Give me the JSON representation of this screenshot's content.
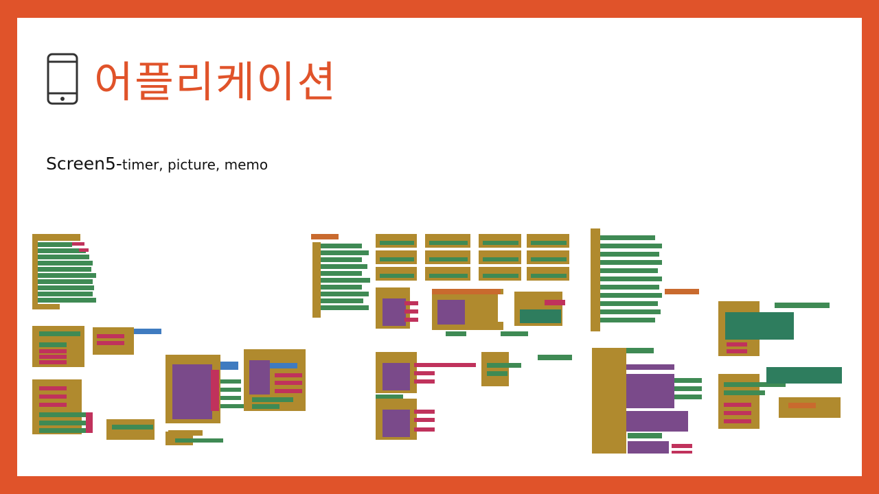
{
  "slide": {
    "title": "어플리케이션",
    "subtitle_main": "Screen5-",
    "subtitle_detail": "timer, picture, memo",
    "icon": "smartphone-icon"
  },
  "colors": {
    "frame": "#e0532a",
    "title": "#e0532a",
    "block_event": "#b08a2e",
    "block_component": "#3f8a54",
    "block_text": "#c0325c",
    "block_procedure": "#7a4a8a",
    "block_math": "#3f7bc0",
    "block_logic": "#c96a2e"
  }
}
